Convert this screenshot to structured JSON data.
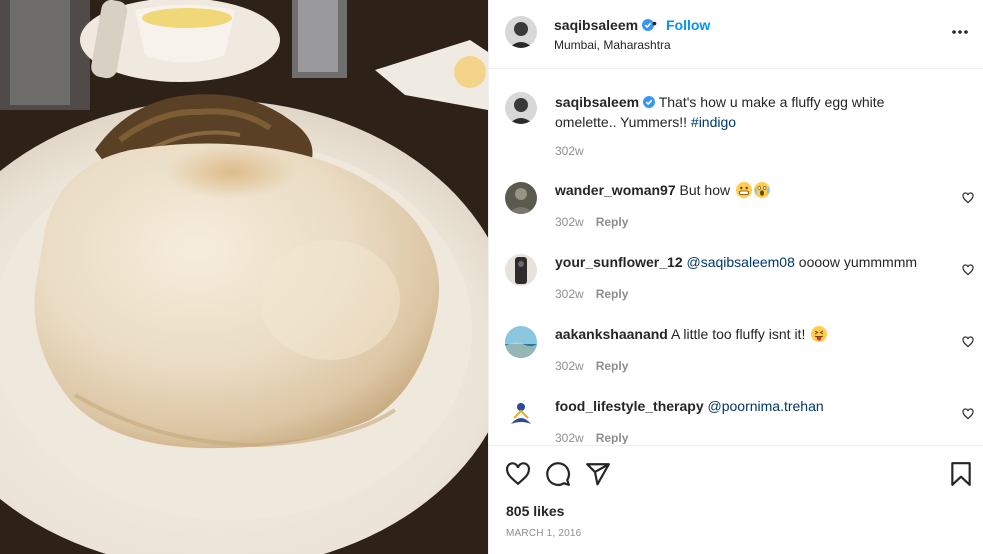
{
  "post": {
    "username": "saqibsaleem",
    "follow_label": "Follow",
    "dot": "•",
    "location": "Mumbai, Maharashtra",
    "caption_user": "saqibsaleem",
    "caption_text": "That's how u make a fluffy egg white omelette.. Yummers!! ",
    "caption_hashtag": "#indigo",
    "caption_time": "302w",
    "likes": "805 likes",
    "date": "MARCH 1, 2016"
  },
  "comments": [
    {
      "user": "wander_woman97",
      "text": "But how ",
      "mention": "",
      "after": "",
      "time": "302w",
      "reply": "Reply",
      "emojis": [
        "grin-emoji",
        "scream-emoji"
      ]
    },
    {
      "user": "your_sunflower_12",
      "text": "",
      "mention": "@saqibsaleem08",
      "after": " oooow yummmmm",
      "time": "302w",
      "reply": "Reply",
      "emojis": []
    },
    {
      "user": "aakankshaanand",
      "text": "A little too fluffy isnt it! ",
      "mention": "",
      "after": "",
      "time": "302w",
      "reply": "Reply",
      "emojis": [
        "tongue-emoji"
      ]
    },
    {
      "user": "food_lifestyle_therapy",
      "text": "",
      "mention": "@poornima.trehan",
      "after": "",
      "time": "302w",
      "reply": "Reply",
      "emojis": []
    }
  ],
  "icons": {
    "verified": "verified-badge-icon",
    "more": "more-options-icon",
    "like": "heart-icon",
    "comment": "comment-bubble-icon",
    "share": "paper-plane-icon",
    "save": "bookmark-icon"
  },
  "colors": {
    "link_blue": "#0095f6",
    "hashtag": "#00376b",
    "muted": "#8e8e8e",
    "verified": "#3897f0"
  }
}
